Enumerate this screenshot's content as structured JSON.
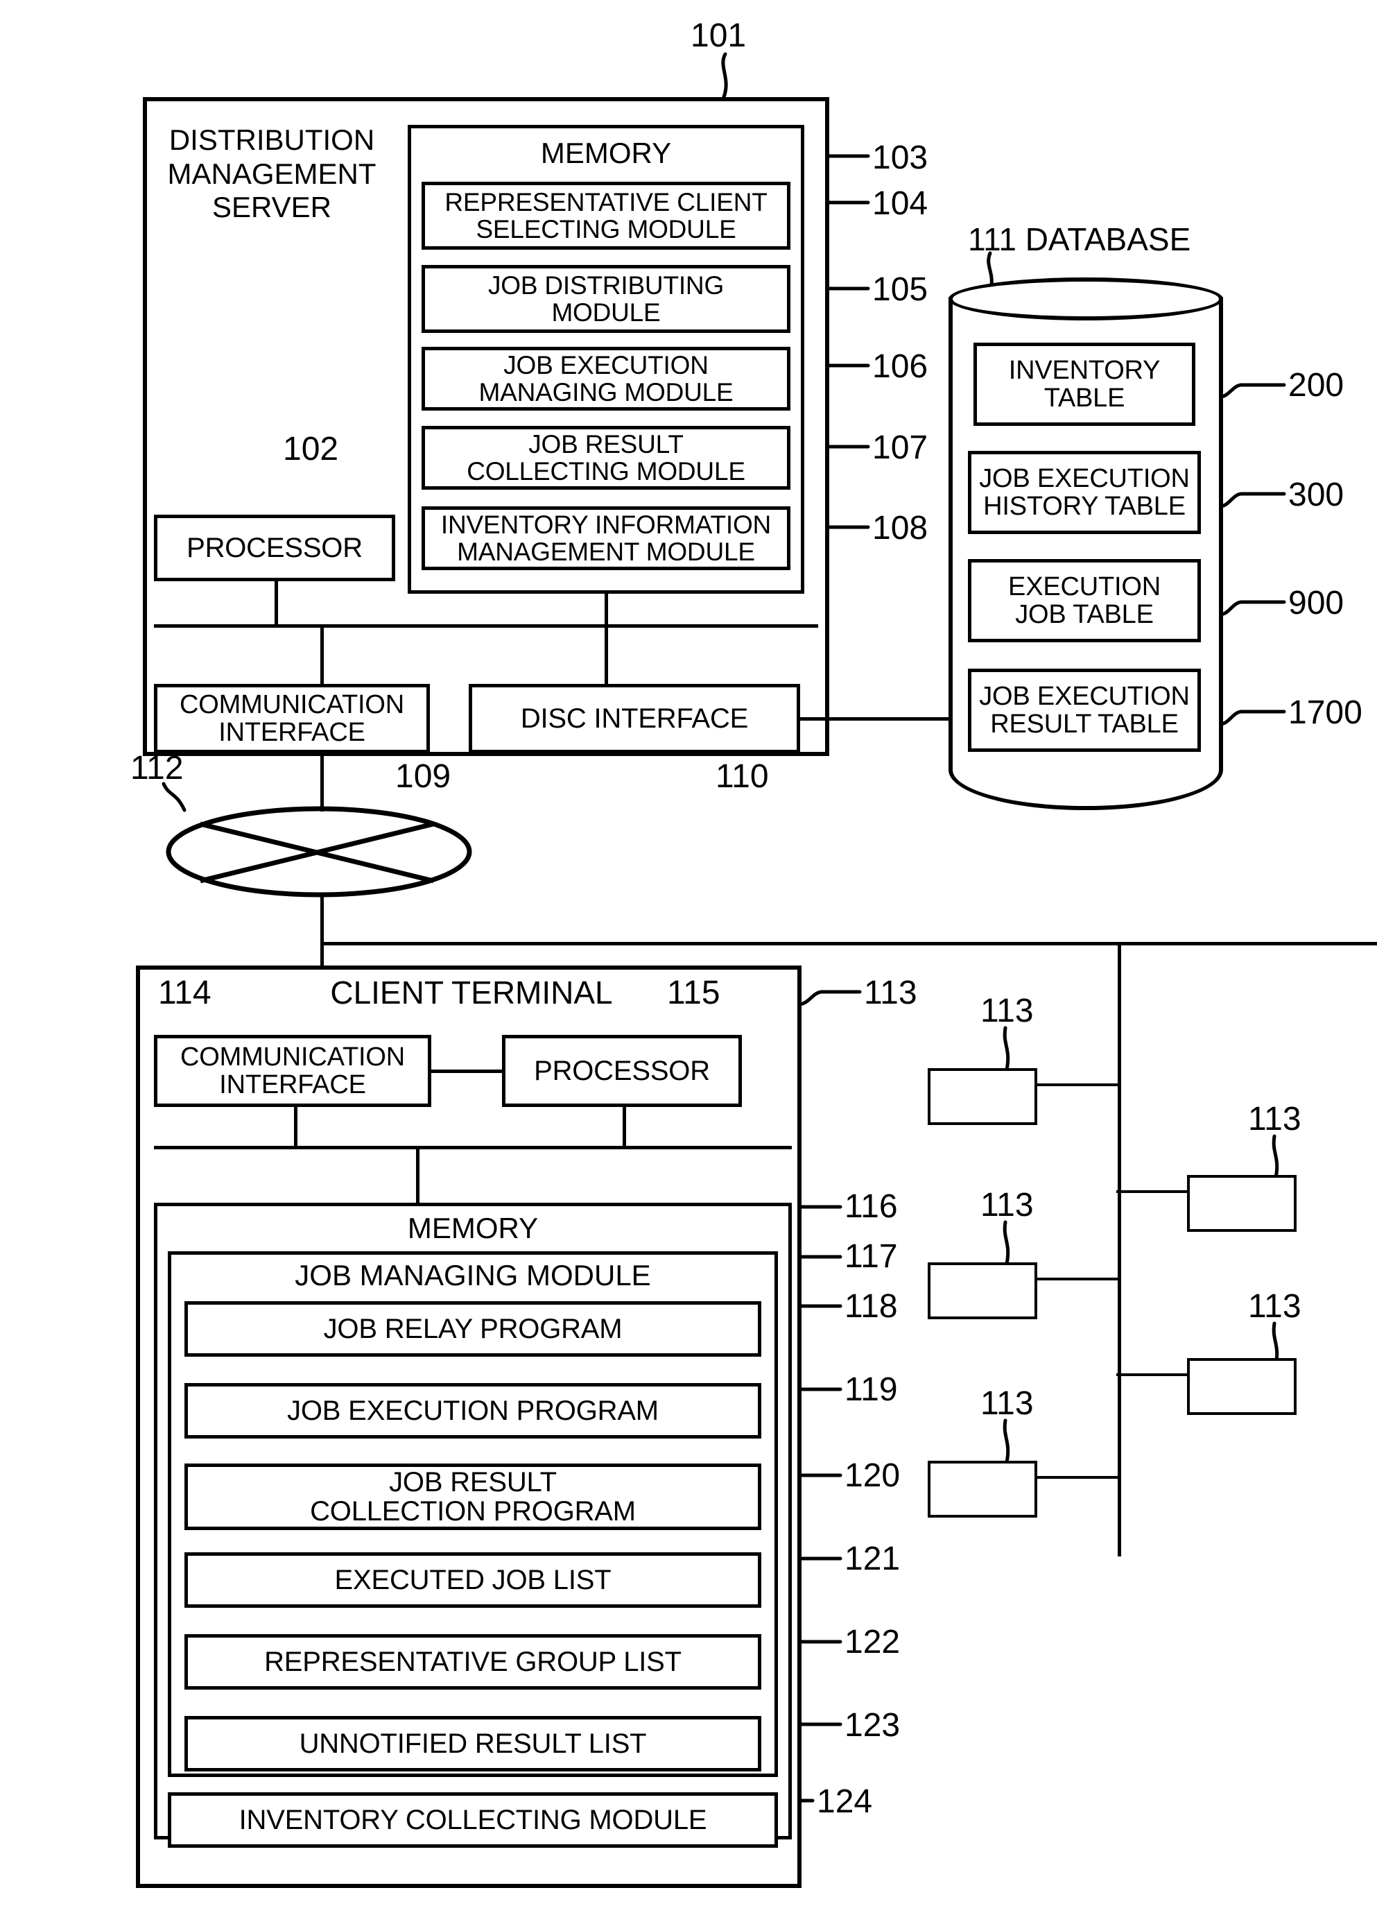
{
  "figure": {
    "type": "patent-block-diagram",
    "server": {
      "ref": "101",
      "title": "DISTRIBUTION\nMANAGEMENT\nSERVER",
      "memory": {
        "ref": "103",
        "title": "MEMORY",
        "modules": [
          {
            "ref": "104",
            "label": "REPRESENTATIVE CLIENT\nSELECTING MODULE"
          },
          {
            "ref": "105",
            "label": "JOB DISTRIBUTING\nMODULE"
          },
          {
            "ref": "106",
            "label": "JOB EXECUTION\nMANAGING MODULE"
          },
          {
            "ref": "107",
            "label": "JOB RESULT\nCOLLECTING MODULE"
          },
          {
            "ref": "108",
            "label": "INVENTORY INFORMATION\nMANAGEMENT MODULE"
          }
        ]
      },
      "processor": {
        "ref": "102",
        "label": "PROCESSOR"
      },
      "communication_interface": {
        "ref": "109",
        "label": "COMMUNICATION\nINTERFACE"
      },
      "disc_interface": {
        "ref": "110",
        "label": "DISC INTERFACE"
      }
    },
    "database": {
      "ref": "111",
      "title": "DATABASE",
      "caption": "111 DATABASE",
      "tables": [
        {
          "ref": "200",
          "label": "INVENTORY\nTABLE"
        },
        {
          "ref": "300",
          "label": "JOB EXECUTION\nHISTORY TABLE"
        },
        {
          "ref": "900",
          "label": "EXECUTION\nJOB TABLE"
        },
        {
          "ref": "1700",
          "label": "JOB EXECUTION\nRESULT TABLE"
        }
      ]
    },
    "network": {
      "ref": "112",
      "label": ""
    },
    "client_terminal": {
      "ref": "113",
      "title": "CLIENT TERMINAL",
      "communication_interface": {
        "ref": "114",
        "label": "COMMUNICATION\nINTERFACE"
      },
      "processor": {
        "ref": "115",
        "label": "PROCESSOR"
      },
      "memory": {
        "ref": "116",
        "title": "MEMORY",
        "job_managing_module": {
          "ref": "117",
          "title": "JOB MANAGING MODULE",
          "items": [
            {
              "ref": "118",
              "label": "JOB RELAY PROGRAM"
            },
            {
              "ref": "119",
              "label": "JOB EXECUTION PROGRAM"
            },
            {
              "ref": "120",
              "label": "JOB RESULT\nCOLLECTION PROGRAM"
            },
            {
              "ref": "121",
              "label": "EXECUTED JOB LIST"
            },
            {
              "ref": "122",
              "label": "REPRESENTATIVE GROUP LIST"
            },
            {
              "ref": "123",
              "label": "UNNOTIFIED RESULT LIST"
            }
          ]
        },
        "inventory_collecting_module": {
          "ref": "124",
          "label": "INVENTORY COLLECTING MODULE"
        }
      }
    },
    "other_clients": [
      {
        "ref": "113"
      },
      {
        "ref": "113"
      },
      {
        "ref": "113"
      },
      {
        "ref": "113"
      },
      {
        "ref": "113"
      }
    ]
  }
}
